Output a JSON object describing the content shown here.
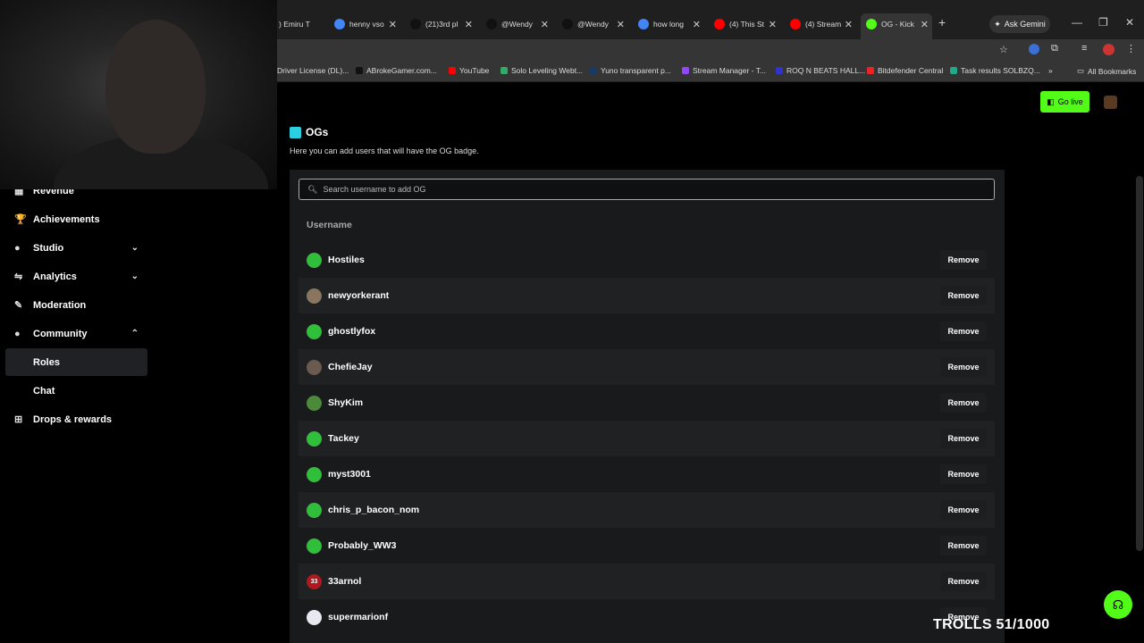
{
  "browser": {
    "tabs": [
      {
        "label": ") Emiru T",
        "icon": "tiktok-icon",
        "color": "#e33"
      },
      {
        "label": "henny vso",
        "icon": "google-icon",
        "color": "#4285f4"
      },
      {
        "label": "(21)3rd pl",
        "icon": "tiktok-icon",
        "color": "#111"
      },
      {
        "label": "@Wendy",
        "icon": "tiktok-icon",
        "color": "#111"
      },
      {
        "label": "@Wendy",
        "icon": "tiktok-icon",
        "color": "#111"
      },
      {
        "label": "how long",
        "icon": "google-icon",
        "color": "#4285f4"
      },
      {
        "label": "(4) This St",
        "icon": "youtube-icon",
        "color": "#f00"
      },
      {
        "label": "(4) Stream",
        "icon": "youtube-icon",
        "color": "#f00"
      },
      {
        "label": "OG - Kick",
        "icon": "kick-icon",
        "color": "#53fc18"
      }
    ],
    "ask_gemini": "Ask Gemini",
    "bookmarks": [
      {
        "label": "Driver License (DL)...",
        "color": "#444"
      },
      {
        "label": "ABrokeGamer.com...",
        "color": "#111"
      },
      {
        "label": "YouTube",
        "color": "#f00"
      },
      {
        "label": "Solo Leveling Webt...",
        "color": "#3a6"
      },
      {
        "label": "Yuno transparent p...",
        "color": "#1a3a6a"
      },
      {
        "label": "Stream Manager - T...",
        "color": "#9146ff"
      },
      {
        "label": "ROQ N BEATS HALL...",
        "color": "#33c"
      },
      {
        "label": "Bitdefender Central",
        "color": "#e22"
      },
      {
        "label": "Task results SOLBZQ...",
        "color": "#2a8"
      }
    ],
    "all_bookmarks": "All Bookmarks",
    "more": "»"
  },
  "sidebar": {
    "items": [
      {
        "label": "Revenue",
        "icon": "dollar-icon",
        "glyph": "▦",
        "chevron": ""
      },
      {
        "label": "Achievements",
        "icon": "trophy-icon",
        "glyph": "🏆",
        "chevron": ""
      },
      {
        "label": "Studio",
        "icon": "video-icon",
        "glyph": "●",
        "chevron": "⌄"
      },
      {
        "label": "Analytics",
        "icon": "analytics-icon",
        "glyph": "⇋",
        "chevron": "⌄"
      },
      {
        "label": "Moderation",
        "icon": "wrench-icon",
        "glyph": "✎",
        "chevron": ""
      },
      {
        "label": "Community",
        "icon": "users-icon",
        "glyph": "●",
        "chevron": "⌃"
      },
      {
        "label": "Roles",
        "icon": "",
        "glyph": "",
        "chevron": ""
      },
      {
        "label": "Chat",
        "icon": "",
        "glyph": "",
        "chevron": ""
      },
      {
        "label": "Drops & rewards",
        "icon": "gift-icon",
        "glyph": "⊞",
        "chevron": ""
      }
    ]
  },
  "header": {
    "go_live": "Go live"
  },
  "og": {
    "title": "OGs",
    "description": "Here you can add users that will have the OG badge.",
    "search_placeholder": "Search username to add OG",
    "column_username": "Username",
    "remove_label": "Remove",
    "users": [
      {
        "name": "Hostiles",
        "avatar_color": "#2fbf3a",
        "avatar_text": ""
      },
      {
        "name": "newyorkerant",
        "avatar_color": "#8a7560",
        "avatar_text": ""
      },
      {
        "name": "ghostlyfox",
        "avatar_color": "#2fbf3a",
        "avatar_text": ""
      },
      {
        "name": "ChefieJay",
        "avatar_color": "#6a5a50",
        "avatar_text": ""
      },
      {
        "name": "ShyKim",
        "avatar_color": "#4a8a3a",
        "avatar_text": ""
      },
      {
        "name": "Tackey",
        "avatar_color": "#2fbf3a",
        "avatar_text": ""
      },
      {
        "name": "myst3001",
        "avatar_color": "#2fbf3a",
        "avatar_text": ""
      },
      {
        "name": "chris_p_bacon_nom",
        "avatar_color": "#2fbf3a",
        "avatar_text": ""
      },
      {
        "name": "Probably_WW3",
        "avatar_color": "#2fbf3a",
        "avatar_text": ""
      },
      {
        "name": "33arnol",
        "avatar_color": "#b01820",
        "avatar_text": "33"
      },
      {
        "name": "supermarionf",
        "avatar_color": "#e8e8f0",
        "avatar_text": ""
      }
    ]
  },
  "overlay": {
    "text": "TROLLS 51/1000"
  }
}
